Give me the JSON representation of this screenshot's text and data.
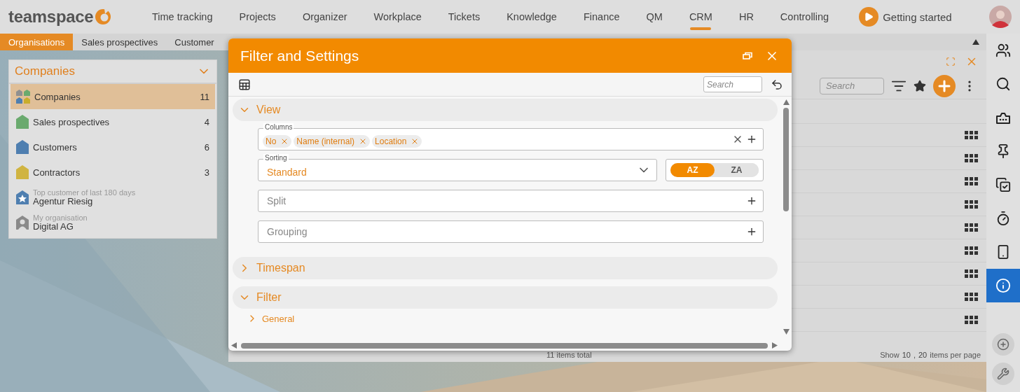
{
  "header": {
    "logo": "teamspace",
    "nav": [
      {
        "label": "Time tracking",
        "selected": false
      },
      {
        "label": "Projects",
        "selected": false
      },
      {
        "label": "Organizer",
        "selected": false
      },
      {
        "label": "Workplace",
        "selected": false
      },
      {
        "label": "Tickets",
        "selected": false
      },
      {
        "label": "Knowledge",
        "selected": false
      },
      {
        "label": "Finance",
        "selected": false
      },
      {
        "label": "QM",
        "selected": false
      },
      {
        "label": "CRM",
        "selected": true
      },
      {
        "label": "HR",
        "selected": false
      },
      {
        "label": "Controlling",
        "selected": false
      }
    ],
    "getting_started": "Getting started"
  },
  "subtabs": [
    {
      "label": "Organisations",
      "selected": true
    },
    {
      "label": "Sales prospectives",
      "selected": false
    },
    {
      "label": "Customer",
      "selected": false
    }
  ],
  "companies_panel": {
    "title": "Companies",
    "items": [
      {
        "kind": "all",
        "label": "Companies",
        "count": "11",
        "selected": true
      },
      {
        "kind": "category",
        "label": "Sales prospectives",
        "count": "4",
        "selected": false,
        "color": "#6aaa6e"
      },
      {
        "kind": "category",
        "label": "Customers",
        "count": "6",
        "selected": false,
        "color": "#4f7fb0"
      },
      {
        "kind": "category",
        "label": "Contractors",
        "count": "3",
        "selected": false,
        "color": "#d0b441"
      },
      {
        "kind": "top",
        "caption": "Top customer of last 180 days",
        "label": "Agentur Riesig",
        "selected": false
      },
      {
        "kind": "own",
        "caption": "My organisation",
        "label": "Digital AG",
        "selected": false
      }
    ]
  },
  "list_panel": {
    "search": {
      "placeholder": "Search"
    },
    "footer": {
      "total": "11 items total",
      "show": "Show",
      "page_sizes": [
        "10",
        "20"
      ],
      "separator": ",",
      "per_page": "items per page"
    }
  },
  "dialog": {
    "title": "Filter and Settings",
    "search": {
      "placeholder": "Search"
    },
    "sections": [
      {
        "title": "View",
        "expanded": true,
        "fields": [
          {
            "kind": "chips",
            "label": "Columns",
            "chips": [
              "No",
              "Name (internal)",
              "Location"
            ]
          },
          {
            "kind": "select",
            "label": "Sorting",
            "value": "Standard",
            "order": [
              {
                "label": "AZ",
                "selected": true
              },
              {
                "label": "ZA",
                "selected": false
              }
            ]
          },
          {
            "kind": "add",
            "placeholder": "Split"
          },
          {
            "kind": "add",
            "placeholder": "Grouping"
          }
        ]
      },
      {
        "title": "Timespan",
        "expanded": false
      },
      {
        "title": "Filter",
        "expanded": true,
        "subsections": [
          {
            "title": "General",
            "expanded": false
          }
        ]
      }
    ]
  },
  "right_sidebar": {
    "items": [
      {
        "kind": "people",
        "selected": false
      },
      {
        "kind": "search",
        "selected": false
      },
      {
        "kind": "ticket",
        "selected": false
      },
      {
        "kind": "pin",
        "selected": false
      },
      {
        "kind": "tasks",
        "selected": false
      },
      {
        "kind": "timer",
        "selected": false
      },
      {
        "kind": "phone",
        "selected": false
      },
      {
        "kind": "info",
        "selected": true
      }
    ],
    "bottom": [
      {
        "kind": "add"
      },
      {
        "kind": "tools"
      }
    ]
  }
}
